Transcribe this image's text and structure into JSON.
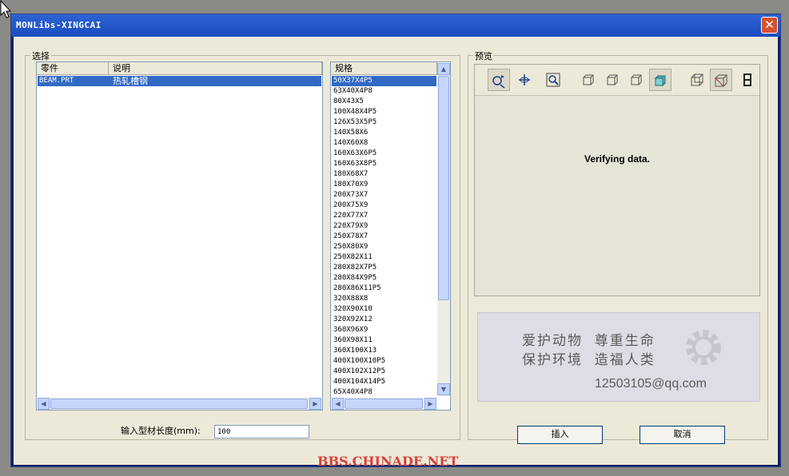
{
  "window": {
    "title": "MONLibs-XINGCAI",
    "close_glyph": "✕"
  },
  "select_group": {
    "label": "选择",
    "columns": [
      "零件",
      "说明"
    ],
    "rows": [
      {
        "part": "BEAM.PRT",
        "desc": "热轧槽钢"
      }
    ]
  },
  "spec": {
    "header": "规格",
    "items": [
      "50X37X4P5",
      "63X40X4P8",
      "80X43X5",
      "100X48X4P5",
      "126X53X5P5",
      "140X58X6",
      "140X60X8",
      "160X63X6P5",
      "160X63X8P5",
      "180X68X7",
      "180X70X9",
      "200X73X7",
      "200X75X9",
      "220X77X7",
      "220X79X9",
      "250X78X7",
      "250X80X9",
      "250X82X11",
      "280X82X7P5",
      "280X84X9P5",
      "280X86X11P5",
      "320X88X8",
      "320X90X10",
      "320X92X12",
      "360X96X9",
      "360X98X11",
      "360X100X13",
      "400X100X10P5",
      "400X102X12P5",
      "400X104X14P5",
      "65X40X4P8"
    ]
  },
  "length": {
    "label": "输入型材长度(mm):",
    "value": "100"
  },
  "preview": {
    "label": "预览",
    "status": "Verifying data.",
    "tools": [
      "rotate-icon",
      "pan-icon",
      "zoom-icon",
      "view-front-icon",
      "view-left-icon",
      "view-right-icon",
      "shaded-cube-icon",
      "wireframe-cube-icon",
      "shaded-box-icon",
      "film-icon"
    ]
  },
  "banner": {
    "line1": "爱护动物  尊重生命",
    "line2": "保护环境  造福人类",
    "email": "12503105@qq.com"
  },
  "buttons": {
    "insert": "插入",
    "cancel": "取消"
  },
  "watermark": "BBS.CHINADE.NET"
}
